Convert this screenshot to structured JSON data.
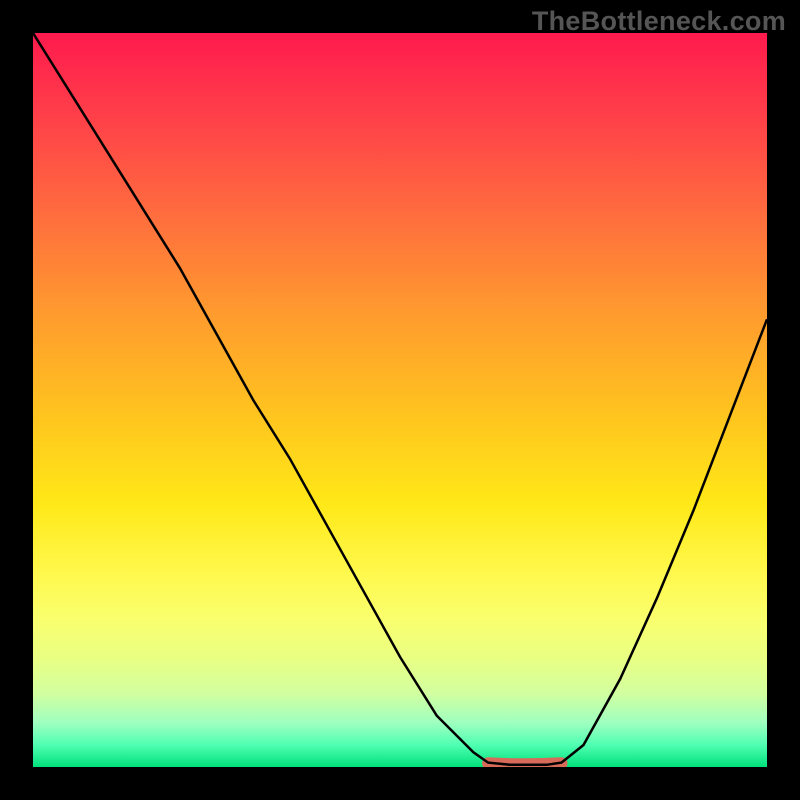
{
  "watermark": "TheBottleneck.com",
  "colors": {
    "frame": "#000000",
    "curve": "#000000",
    "valley_marker": "#d86a5a",
    "gradient_stops": [
      "#ff1a4d",
      "#ff3b4a",
      "#ff6a3f",
      "#ff9a2e",
      "#ffc41f",
      "#ffe817",
      "#fff94f",
      "#f9ff6e",
      "#eaff82",
      "#d2ffa0",
      "#9effc0",
      "#4fffb2",
      "#00e07a"
    ]
  },
  "chart_data": {
    "type": "line",
    "title": "",
    "xlabel": "",
    "ylabel": "",
    "xlim": [
      0,
      100
    ],
    "ylim": [
      0,
      100
    ],
    "grid": false,
    "note": "Axis ticks and labels are not shown in the image; x is treated as 0–100 left→right and y as 0–100 bottom→top. Values below are estimated from pixel positions.",
    "series": [
      {
        "name": "bottleneck-curve",
        "x": [
          0,
          5,
          10,
          15,
          20,
          25,
          30,
          35,
          40,
          45,
          50,
          55,
          60,
          62,
          65,
          70,
          72,
          75,
          80,
          85,
          90,
          95,
          100
        ],
        "y": [
          100,
          92,
          84,
          76,
          68,
          59,
          50,
          42,
          33,
          24,
          15,
          7,
          2,
          0.6,
          0.3,
          0.3,
          0.6,
          3,
          12,
          23,
          35,
          48,
          61
        ]
      }
    ],
    "annotations": [
      {
        "name": "valley-flat-segment",
        "x_range": [
          62,
          72
        ],
        "y": 0.5,
        "style": "thick-rounded",
        "color": "#d86a5a"
      }
    ]
  }
}
